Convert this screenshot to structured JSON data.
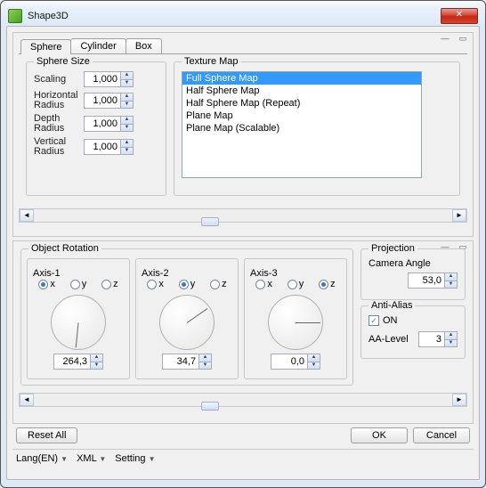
{
  "window": {
    "title": "Shape3D"
  },
  "tabs": [
    {
      "label": "Sphere",
      "active": true
    },
    {
      "label": "Cylinder",
      "active": false
    },
    {
      "label": "Box",
      "active": false
    }
  ],
  "sphere_size": {
    "legend": "Sphere Size",
    "rows": [
      {
        "label": "Scaling",
        "value": "1,000"
      },
      {
        "label": "Horizontal Radius",
        "value": "1,000"
      },
      {
        "label": "Depth Radius",
        "value": "1,000"
      },
      {
        "label": "Vertical Radius",
        "value": "1,000"
      }
    ]
  },
  "texture_map": {
    "legend": "Texture Map",
    "items": [
      {
        "label": "Full Sphere Map",
        "selected": true
      },
      {
        "label": "Half Sphere Map",
        "selected": false
      },
      {
        "label": "Half Sphere Map (Repeat)",
        "selected": false
      },
      {
        "label": "Plane Map",
        "selected": false
      },
      {
        "label": "Plane Map (Scalable)",
        "selected": false
      }
    ]
  },
  "object_rotation": {
    "legend": "Object Rotation",
    "axes": [
      {
        "legend": "Axis-1",
        "selected": "x",
        "angle": 264.3,
        "value": "264,3"
      },
      {
        "legend": "Axis-2",
        "selected": "y",
        "angle": 34.7,
        "value": "34,7"
      },
      {
        "legend": "Axis-3",
        "selected": "z",
        "angle": 0.0,
        "value": "0,0"
      }
    ],
    "xyz": [
      "x",
      "y",
      "z"
    ]
  },
  "projection": {
    "legend": "Projection",
    "camera_label": "Camera Angle",
    "camera_value": "53,0"
  },
  "antialias": {
    "legend": "Anti-Alias",
    "on_label": "ON",
    "on_checked": true,
    "level_label": "AA-Level",
    "level_value": "3"
  },
  "buttons": {
    "reset": "Reset All",
    "ok": "OK",
    "cancel": "Cancel"
  },
  "statusbar": [
    {
      "label": "Lang(EN)"
    },
    {
      "label": "XML"
    },
    {
      "label": "Setting"
    }
  ]
}
